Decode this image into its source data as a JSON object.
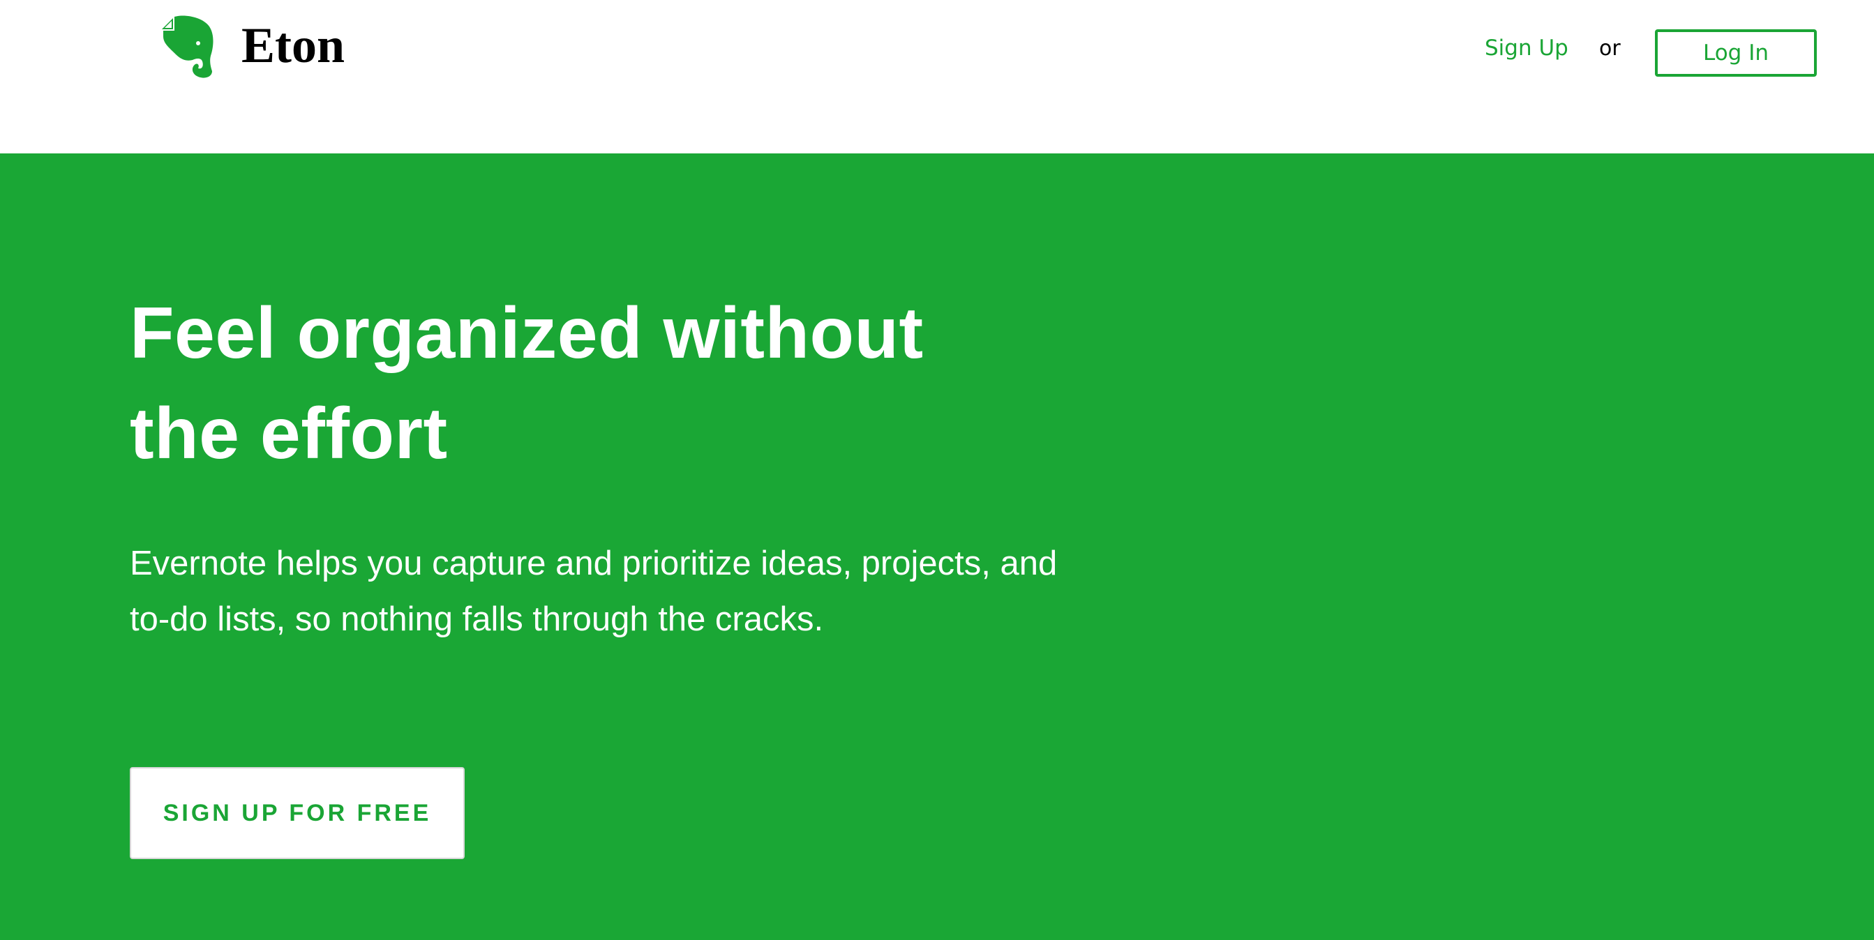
{
  "colors": {
    "brand_green": "#1aa535",
    "hero_background": "#1aa735",
    "header_background": "#ffffff"
  },
  "header": {
    "logo_icon": "elephant-icon",
    "logo_text": "Eton",
    "signup_label": "Sign Up",
    "or_text": "or",
    "login_label": "Log In"
  },
  "hero": {
    "title_line1": "Feel organized without",
    "title_line2": "the effort",
    "subtitle_line1": "Evernote helps you capture and prioritize ideas, projects, and",
    "subtitle_line2": "to-do lists, so nothing falls through the cracks.",
    "cta_label": "SIGN UP FOR FREE"
  }
}
